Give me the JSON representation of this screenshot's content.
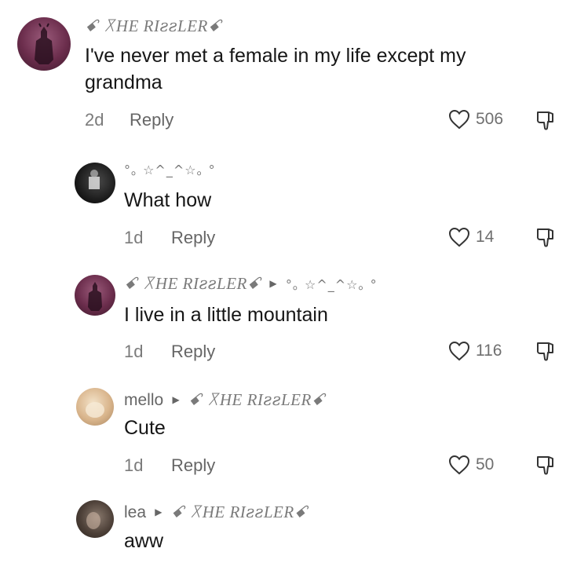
{
  "comments": [
    {
      "username_fancy": "ꗃ ꓃HE RIꙅꙅLERꗃ",
      "text_line1": "I've never met a female in my life except my",
      "text_line2": "grandma",
      "time": "2d",
      "reply": "Reply",
      "likes": "506"
    },
    {
      "username_kao": "°｡ ☆^_^☆｡ °",
      "text": "What how",
      "time": "1d",
      "reply": "Reply",
      "likes": "14"
    },
    {
      "username_fancy": "ꗃ ꓃HE RIꙅꙅLERꗃ",
      "reply_to": "°｡ ☆^_^☆｡ °",
      "text": "I live in a little mountain",
      "time": "1d",
      "reply": "Reply",
      "likes": "116"
    },
    {
      "username": "mello",
      "reply_to": "ꗃ ꓃HE RIꙅꙅLERꗃ",
      "text": "Cute",
      "time": "1d",
      "reply": "Reply",
      "likes": "50"
    },
    {
      "username": "lea",
      "reply_to": "ꗃ ꓃HE RIꙅꙅLERꗃ",
      "text": "aww"
    }
  ],
  "icons": {
    "like": "heart-outline-icon",
    "dislike": "thumbs-down-icon"
  },
  "colors": {
    "text": "#161616",
    "muted": "#7b7b7b",
    "background": "#ffffff"
  }
}
